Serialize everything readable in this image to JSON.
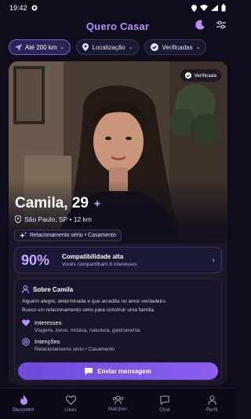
{
  "status": {
    "time": "19:42"
  },
  "header": {
    "title": "Quero Casar",
    "moon_icon": "moon-icon",
    "settings_icon": "sliders-icon"
  },
  "filters": [
    {
      "label": "Até 200 km",
      "icon": "navigation-icon",
      "active": true
    },
    {
      "label": "Localização",
      "icon": "location-pin-icon",
      "active": false
    },
    {
      "label": "Verificadas",
      "icon": "check-circle-icon",
      "active": false
    }
  ],
  "profile": {
    "verified_label": "Verificada",
    "name": "Camila, 29",
    "location": "São Paulo, SP • 12 km",
    "goal": "Relacionamento sério • Casamento"
  },
  "compatibility": {
    "percent": "90%",
    "title": "Compatibilidade alta",
    "subtitle": "Vocês compartilham 8 interesses"
  },
  "about": {
    "title": "Sobre Camila",
    "text_1": "Alguém alegre, determinada e que acredita no amor verdadeiro.",
    "text_2": "Busco um relacionamento sério para construir uma família.",
    "interests_title": "Interesses",
    "interests_value": "Viagens, livros, música, natureza, gastronomia",
    "intentions_title": "Intenções",
    "intentions_value": "Relacionamento sério • Casamento"
  },
  "send_button": "Enviar mensagem",
  "nav": [
    {
      "label": "Descobrir",
      "icon": "flame-icon",
      "active": true
    },
    {
      "label": "Likes",
      "icon": "heart-icon",
      "active": false
    },
    {
      "label": "Matches",
      "icon": "people-icon",
      "active": false
    },
    {
      "label": "Chat",
      "icon": "chat-icon",
      "active": false
    },
    {
      "label": "Perfil",
      "icon": "person-icon",
      "active": false
    }
  ],
  "colors": {
    "accent": "#b98cff",
    "background": "#0f0d1c",
    "button": "#7a55e2"
  }
}
